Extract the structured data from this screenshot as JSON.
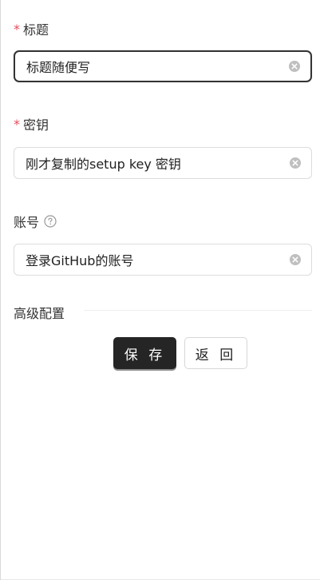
{
  "form": {
    "title_field": {
      "required_mark": "*",
      "label": "标题",
      "value": "标题随便写"
    },
    "secret_field": {
      "required_mark": "*",
      "label": "密钥",
      "value": "刚才复制的setup key 密钥"
    },
    "account_field": {
      "label": "账号",
      "value": "登录GitHub的账号"
    },
    "advanced_section": {
      "label": "高级配置"
    },
    "buttons": {
      "save_label": "保 存",
      "back_label": "返 回"
    }
  },
  "colors": {
    "required": "#e34d59",
    "primary_button": "#252525",
    "focus_border": "#333333"
  },
  "icons": {
    "clear": "clear-icon",
    "help": "help-icon"
  }
}
